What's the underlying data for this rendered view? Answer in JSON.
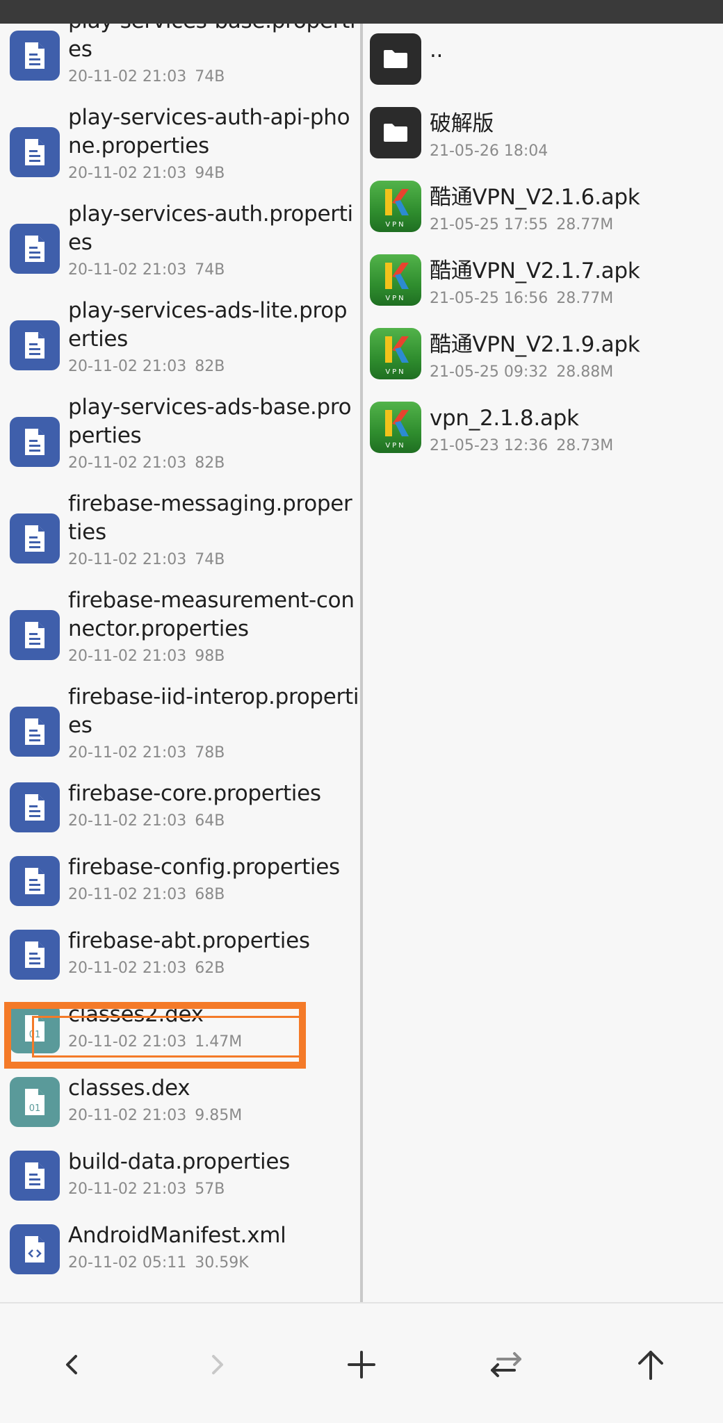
{
  "left_pane": {
    "items": [
      {
        "name": "play-services-base.properties",
        "date": "20-11-02 21:03",
        "size": "74B",
        "type": "doc"
      },
      {
        "name": "play-services-auth-api-phone.properties",
        "date": "20-11-02 21:03",
        "size": "94B",
        "type": "doc"
      },
      {
        "name": "play-services-auth.properties",
        "date": "20-11-02 21:03",
        "size": "74B",
        "type": "doc"
      },
      {
        "name": "play-services-ads-lite.properties",
        "date": "20-11-02 21:03",
        "size": "82B",
        "type": "doc"
      },
      {
        "name": "play-services-ads-base.properties",
        "date": "20-11-02 21:03",
        "size": "82B",
        "type": "doc"
      },
      {
        "name": "firebase-messaging.properties",
        "date": "20-11-02 21:03",
        "size": "74B",
        "type": "doc"
      },
      {
        "name": "firebase-measurement-connector.properties",
        "date": "20-11-02 21:03",
        "size": "98B",
        "type": "doc"
      },
      {
        "name": "firebase-iid-interop.properties",
        "date": "20-11-02 21:03",
        "size": "78B",
        "type": "doc"
      },
      {
        "name": "firebase-core.properties",
        "date": "20-11-02 21:03",
        "size": "64B",
        "type": "doc"
      },
      {
        "name": "firebase-config.properties",
        "date": "20-11-02 21:03",
        "size": "68B",
        "type": "doc"
      },
      {
        "name": "firebase-abt.properties",
        "date": "20-11-02 21:03",
        "size": "62B",
        "type": "doc"
      },
      {
        "name": "classes2.dex",
        "date": "20-11-02 21:03",
        "size": "1.47M",
        "type": "dex"
      },
      {
        "name": "classes.dex",
        "date": "20-11-02 21:03",
        "size": "9.85M",
        "type": "dex"
      },
      {
        "name": "build-data.properties",
        "date": "20-11-02 21:03",
        "size": "57B",
        "type": "doc"
      },
      {
        "name": "AndroidManifest.xml",
        "date": "20-11-02 05:11",
        "size": "30.59K",
        "type": "xml"
      }
    ]
  },
  "right_pane": {
    "items": [
      {
        "name": "..",
        "date": "",
        "size": "",
        "type": "folder"
      },
      {
        "name": "破解版",
        "date": "21-05-26 18:04",
        "size": "",
        "type": "folder"
      },
      {
        "name": "酷通VPN_V2.1.6.apk",
        "date": "21-05-25 17:55",
        "size": "28.77M",
        "type": "apk"
      },
      {
        "name": "酷通VPN_V2.1.7.apk",
        "date": "21-05-25 16:56",
        "size": "28.77M",
        "type": "apk"
      },
      {
        "name": "酷通VPN_V2.1.9.apk",
        "date": "21-05-25 09:32",
        "size": "28.88M",
        "type": "apk"
      },
      {
        "name": "vpn_2.1.8.apk",
        "date": "21-05-23 12:36",
        "size": "28.73M",
        "type": "apk"
      }
    ]
  },
  "icons": {
    "doc": "document-icon",
    "dex": "dex-file-icon",
    "xml": "code-file-icon",
    "folder": "folder-icon",
    "apk": "apk-app-icon",
    "dex_label": "01",
    "apk_badge": "VPN",
    "apk_letter": "K"
  },
  "highlighted_item": "classes2.dex",
  "colors": {
    "doc_icon_bg": "#3f5fab",
    "dex_icon_bg": "#5a9a9a",
    "folder_icon_bg": "#2b2b2b",
    "highlight": "#f47a28"
  },
  "bottom_nav": {
    "back": "chevron-left-icon",
    "forward": "chevron-right-icon",
    "add": "plus-icon",
    "swap": "swap-arrows-icon",
    "up": "arrow-up-icon"
  }
}
